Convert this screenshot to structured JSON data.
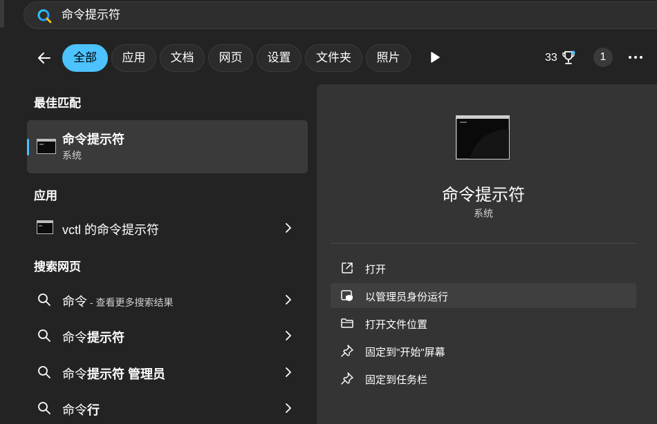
{
  "search": {
    "query": "命令提示符"
  },
  "filters": {
    "back_label": "",
    "chips": [
      {
        "label": "全部",
        "active": true
      },
      {
        "label": "应用",
        "active": false
      },
      {
        "label": "文档",
        "active": false
      },
      {
        "label": "网页",
        "active": false
      },
      {
        "label": "设置",
        "active": false
      },
      {
        "label": "文件夹",
        "active": false
      },
      {
        "label": "照片",
        "active": false
      }
    ],
    "rewards_points": "33",
    "profile_count": "1"
  },
  "results": {
    "best_match_heading": "最佳匹配",
    "best_match": {
      "title": "命令提示符",
      "subtitle": "系统"
    },
    "apps_heading": "应用",
    "apps": [
      {
        "label": "vctl 的命令提示符"
      }
    ],
    "web_heading": "搜索网页",
    "web": [
      {
        "main": "命令",
        "bold": "",
        "suffix": " - 查看更多搜索结果"
      },
      {
        "main": "命令",
        "bold": "提示符",
        "suffix": ""
      },
      {
        "main": "命令",
        "bold": "提示符 管理员",
        "suffix": ""
      },
      {
        "main": "命令",
        "bold": "行",
        "suffix": ""
      }
    ]
  },
  "preview": {
    "title": "命令提示符",
    "subtitle": "系统",
    "actions": [
      {
        "label": "打开",
        "icon": "open-external-icon"
      },
      {
        "label": "以管理员身份运行",
        "icon": "shield-admin-icon"
      },
      {
        "label": "打开文件位置",
        "icon": "folder-icon"
      },
      {
        "label": "固定到\"开始\"屏幕",
        "icon": "pin-icon"
      },
      {
        "label": "固定到任务栏",
        "icon": "pin-icon"
      }
    ]
  },
  "colors": {
    "accent": "#4cc2ff",
    "background": "#232323",
    "panel": "#343434",
    "selected": "#3a3a3a"
  }
}
